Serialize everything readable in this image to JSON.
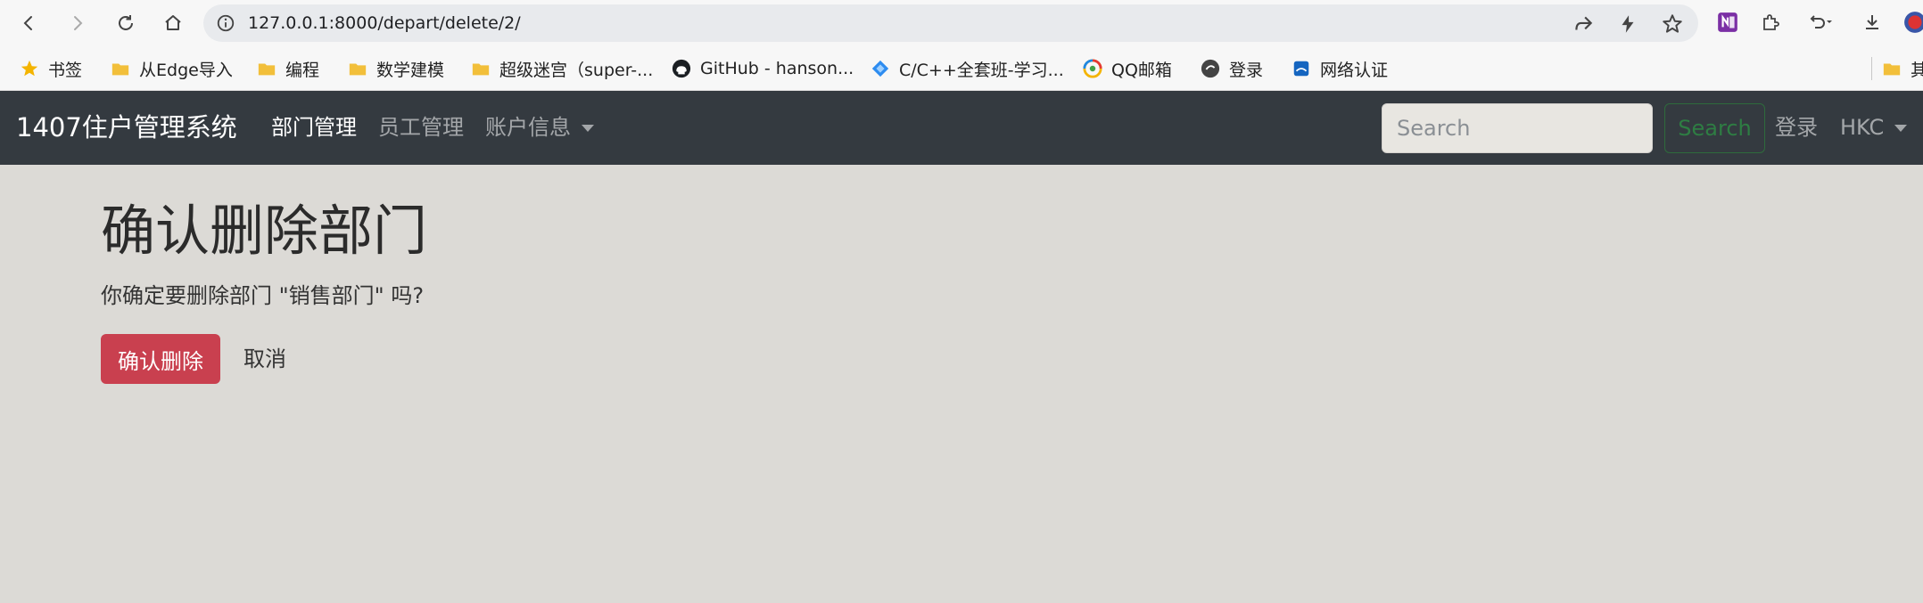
{
  "browser": {
    "url": "127.0.0.1:8000/depart/delete/2/"
  },
  "bookmarks": [
    {
      "label": "书签",
      "icon": "star-icon"
    },
    {
      "label": "从Edge导入",
      "icon": "folder-icon"
    },
    {
      "label": "编程",
      "icon": "folder-icon"
    },
    {
      "label": "数学建模",
      "icon": "folder-icon"
    },
    {
      "label": "超级迷宫（super-...",
      "icon": "folder-icon"
    },
    {
      "label": "GitHub - hanson...",
      "icon": "github-icon"
    },
    {
      "label": "C/C++全套班-学习...",
      "icon": "diamond-icon"
    },
    {
      "label": "QQ邮箱",
      "icon": "qq-mail-icon"
    },
    {
      "label": "登录",
      "icon": "login-icon"
    },
    {
      "label": "网络认证",
      "icon": "network-auth-icon"
    },
    {
      "label": "其",
      "icon": "folder-icon"
    }
  ],
  "navbar": {
    "brand": "1407住户管理系统",
    "links": [
      {
        "label": "部门管理",
        "active": true
      },
      {
        "label": "员工管理",
        "active": false
      },
      {
        "label": "账户信息",
        "active": false
      }
    ],
    "search_placeholder": "Search",
    "search_button": "Search",
    "login": "登录",
    "user": "HKC"
  },
  "main": {
    "title": "确认删除部门",
    "message": "你确定要删除部门 \"销售部门\" 吗?",
    "confirm_button": "确认删除",
    "cancel_link": "取消"
  },
  "colors": {
    "navbar_bg": "#343a40",
    "page_bg": "#dcdad6",
    "danger": "#c9404f",
    "success_outline": "#2e6b3c"
  }
}
